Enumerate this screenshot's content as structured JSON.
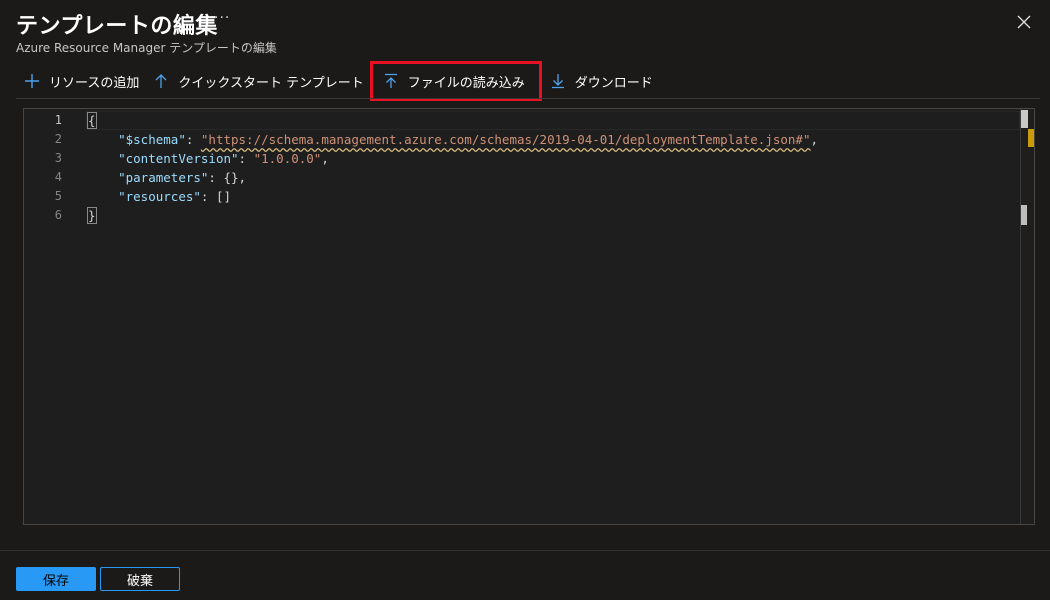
{
  "header": {
    "title": "テンプレートの編集",
    "more_label": "···",
    "subtitle": "Azure Resource Manager テンプレートの編集"
  },
  "toolbar": {
    "items": [
      {
        "label": "リソースの追加",
        "icon": "plus-icon"
      },
      {
        "label": "クイックスタート テンプレート",
        "icon": "arrow-up-icon"
      },
      {
        "label": "ファイルの読み込み",
        "icon": "upload-icon",
        "highlighted": true
      },
      {
        "label": "ダウンロード",
        "icon": "download-icon"
      }
    ]
  },
  "editor": {
    "line_numbers": [
      "1",
      "2",
      "3",
      "4",
      "5",
      "6"
    ],
    "active_line": "1",
    "lines": [
      {
        "tokens": [
          {
            "t": "p",
            "v": "{"
          }
        ]
      },
      {
        "tokens": [
          {
            "t": "k",
            "v": "\"$schema\""
          },
          {
            "t": "p",
            "v": ": "
          },
          {
            "t": "s",
            "v": "\"https://schema.management.azure.com/schemas/2019-04-01/deploymentTemplate.json#\""
          },
          {
            "t": "p",
            "v": ","
          }
        ]
      },
      {
        "tokens": [
          {
            "t": "k",
            "v": "\"contentVersion\""
          },
          {
            "t": "p",
            "v": ": "
          },
          {
            "t": "s",
            "v": "\"1.0.0.0\""
          },
          {
            "t": "p",
            "v": ","
          }
        ]
      },
      {
        "tokens": [
          {
            "t": "k",
            "v": "\"parameters\""
          },
          {
            "t": "p",
            "v": ": {},"
          }
        ]
      },
      {
        "tokens": [
          {
            "t": "k",
            "v": "\"resources\""
          },
          {
            "t": "p",
            "v": ": []"
          }
        ]
      },
      {
        "tokens": [
          {
            "t": "p",
            "v": "}"
          }
        ]
      }
    ]
  },
  "footer": {
    "save_label": "保存",
    "discard_label": "破棄"
  },
  "colors": {
    "background": "#1b1a19",
    "accent": "#2899f5",
    "highlight_border": "#e81123",
    "json_key": "#9cdcfe",
    "json_string": "#ce9178"
  }
}
